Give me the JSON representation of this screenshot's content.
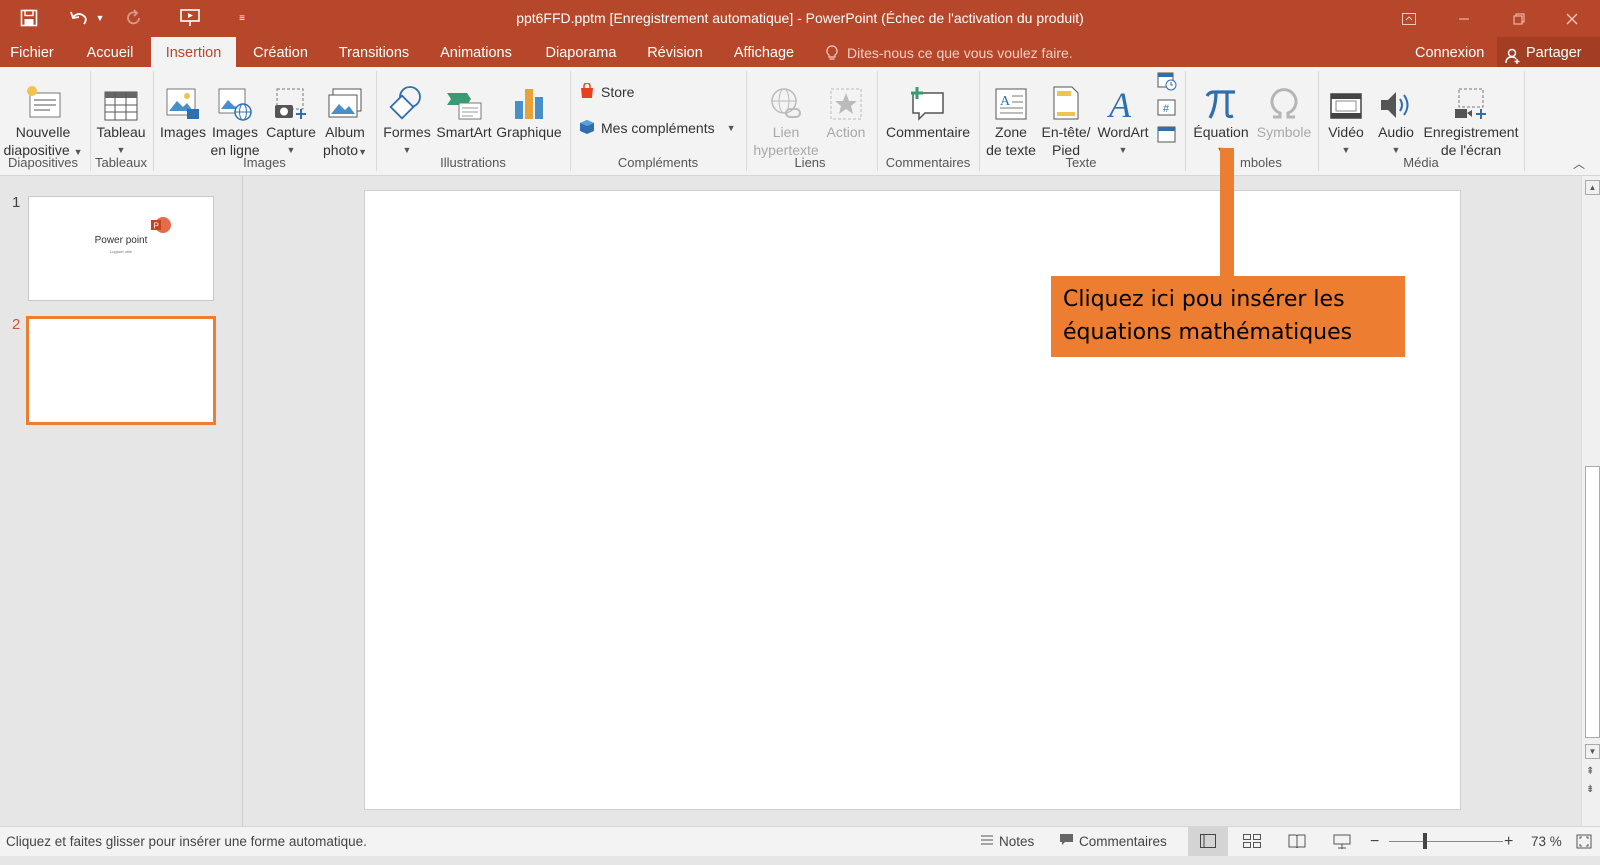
{
  "window": {
    "title": "ppt6FFD.pptm [Enregistrement automatique] - PowerPoint (Échec de l'activation du produit)"
  },
  "tabs": {
    "file": "Fichier",
    "home": "Accueil",
    "insert": "Insertion",
    "design": "Création",
    "transitions": "Transitions",
    "animations": "Animations",
    "slideshow": "Diaporama",
    "review": "Révision",
    "view": "Affichage",
    "tellme": "Dites-nous ce que vous voulez faire.",
    "signin": "Connexion",
    "share": "Partager"
  },
  "ribbon": {
    "new_slide": [
      "Nouvelle",
      "diapositive"
    ],
    "table": "Tableau",
    "images": "Images",
    "online_images": [
      "Images",
      "en ligne"
    ],
    "capture": "Capture",
    "album": [
      "Album",
      "photo"
    ],
    "shapes": "Formes",
    "smartart": "SmartArt",
    "chart": "Graphique",
    "store": "Store",
    "my_addins": "Mes compléments",
    "hyperlink": [
      "Lien",
      "hypertexte"
    ],
    "action": "Action",
    "comment": "Commentaire",
    "textbox": [
      "Zone",
      "de texte"
    ],
    "header_footer": [
      "En-tête/",
      "Pied"
    ],
    "wordart": "WordArt",
    "equation": "Équation",
    "symbol": "Symbole",
    "video": "Vidéo",
    "audio": "Audio",
    "screen_recording": [
      "Enregistrement",
      "de l'écran"
    ],
    "groups": {
      "slides": "Diapositives",
      "tables": "Tableaux",
      "images": "Images",
      "illustrations": "Illustrations",
      "addins": "Compléments",
      "links": "Liens",
      "comments": "Commentaires",
      "text": "Texte",
      "symbols": "mboles",
      "media": "Média"
    }
  },
  "slides": {
    "thumb1_num": "1",
    "thumb1_title": "Power point",
    "thumb1_subtitle": "Logiciel utile",
    "thumb2_num": "2"
  },
  "callout": {
    "line1": "Cliquez ici pou insérer les",
    "line2": "équations mathématiques"
  },
  "status": {
    "message": "Cliquez et faites glisser pour insérer une forme automatique.",
    "notes": "Notes",
    "comments": "Commentaires",
    "zoom": "73 %"
  },
  "colors": {
    "accent": "#b7472a",
    "callout": "#ed7d31",
    "selected_slide_border": "#ed7d31"
  }
}
